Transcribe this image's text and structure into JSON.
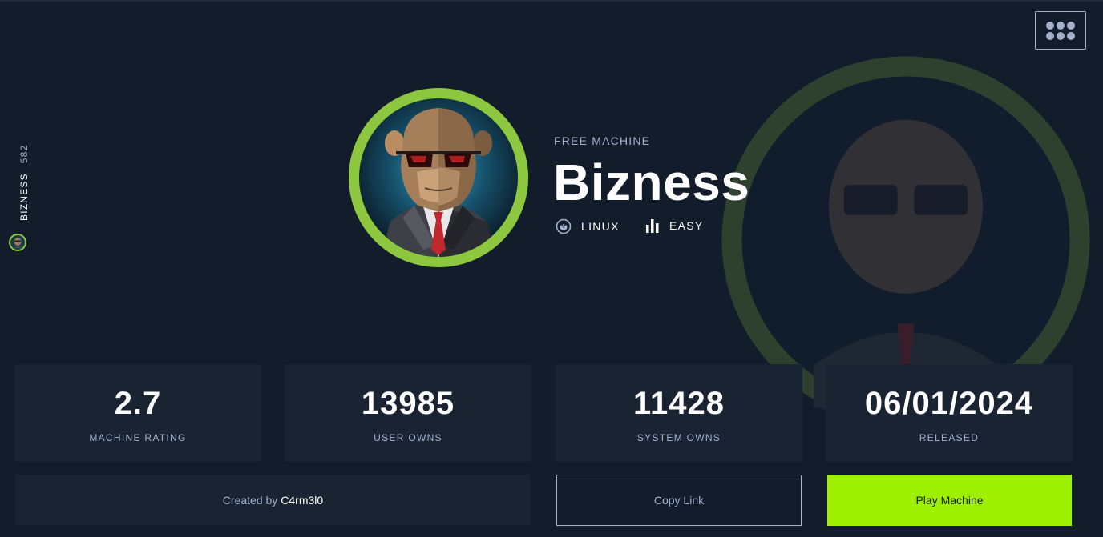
{
  "side": {
    "name": "BIZNESS",
    "id": "582"
  },
  "machine": {
    "tag": "FREE MACHINE",
    "name": "Bizness",
    "os": "LINUX",
    "difficulty": "EASY"
  },
  "stats": [
    {
      "value": "2.7",
      "label": "MACHINE RATING"
    },
    {
      "value": "13985",
      "label": "USER OWNS"
    },
    {
      "value": "11428",
      "label": "SYSTEM OWNS"
    },
    {
      "value": "06/01/2024",
      "label": "RELEASED"
    }
  ],
  "creator": {
    "prefix": "Created by",
    "name": "C4rm3l0"
  },
  "actions": {
    "copy_label": "Copy Link",
    "play_label": "Play Machine"
  },
  "colors": {
    "background": "#131c2a",
    "card": "#1a2332",
    "accent_green": "#9fef00",
    "ring_green": "#8dc63f",
    "muted_text": "#a4b1cd"
  },
  "icons": {
    "menu": "grid-dots-icon",
    "os": "linux-penguin-icon",
    "difficulty": "bar-chart-icon"
  }
}
